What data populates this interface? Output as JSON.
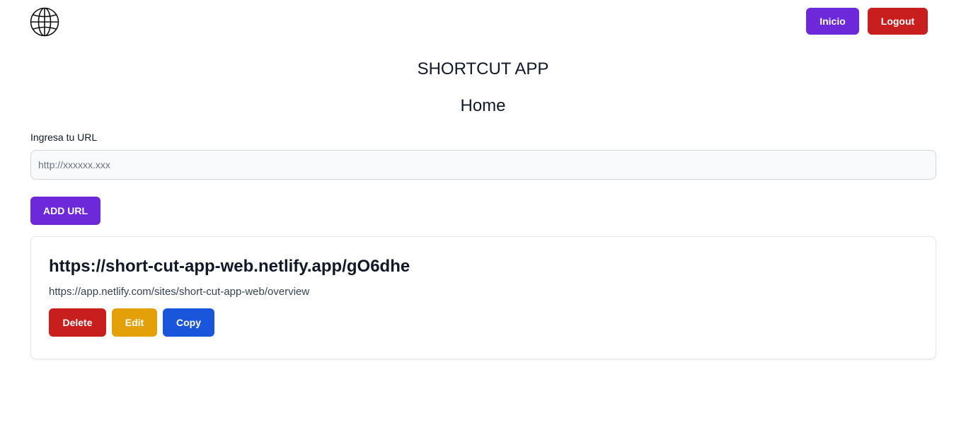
{
  "header": {
    "logo_icon": "globe-icon",
    "nav": {
      "inicio_label": "Inicio",
      "logout_label": "Logout"
    }
  },
  "main": {
    "app_title": "SHORTCUT APP",
    "page_heading": "Home",
    "form": {
      "label": "Ingresa tu URL",
      "input_value": "",
      "placeholder": "http://xxxxxx.xxx",
      "submit_label": "ADD URL"
    },
    "links": [
      {
        "short_url": "https://short-cut-app-web.netlify.app/gO6dhe",
        "original_url": "https://app.netlify.com/sites/short-cut-app-web/overview",
        "actions": {
          "delete_label": "Delete",
          "edit_label": "Edit",
          "copy_label": "Copy"
        }
      }
    ]
  },
  "colors": {
    "primary_purple": "#6d28d9",
    "danger_red": "#c81e1e",
    "warning_yellow": "#e3a008",
    "info_blue": "#1a56db"
  }
}
